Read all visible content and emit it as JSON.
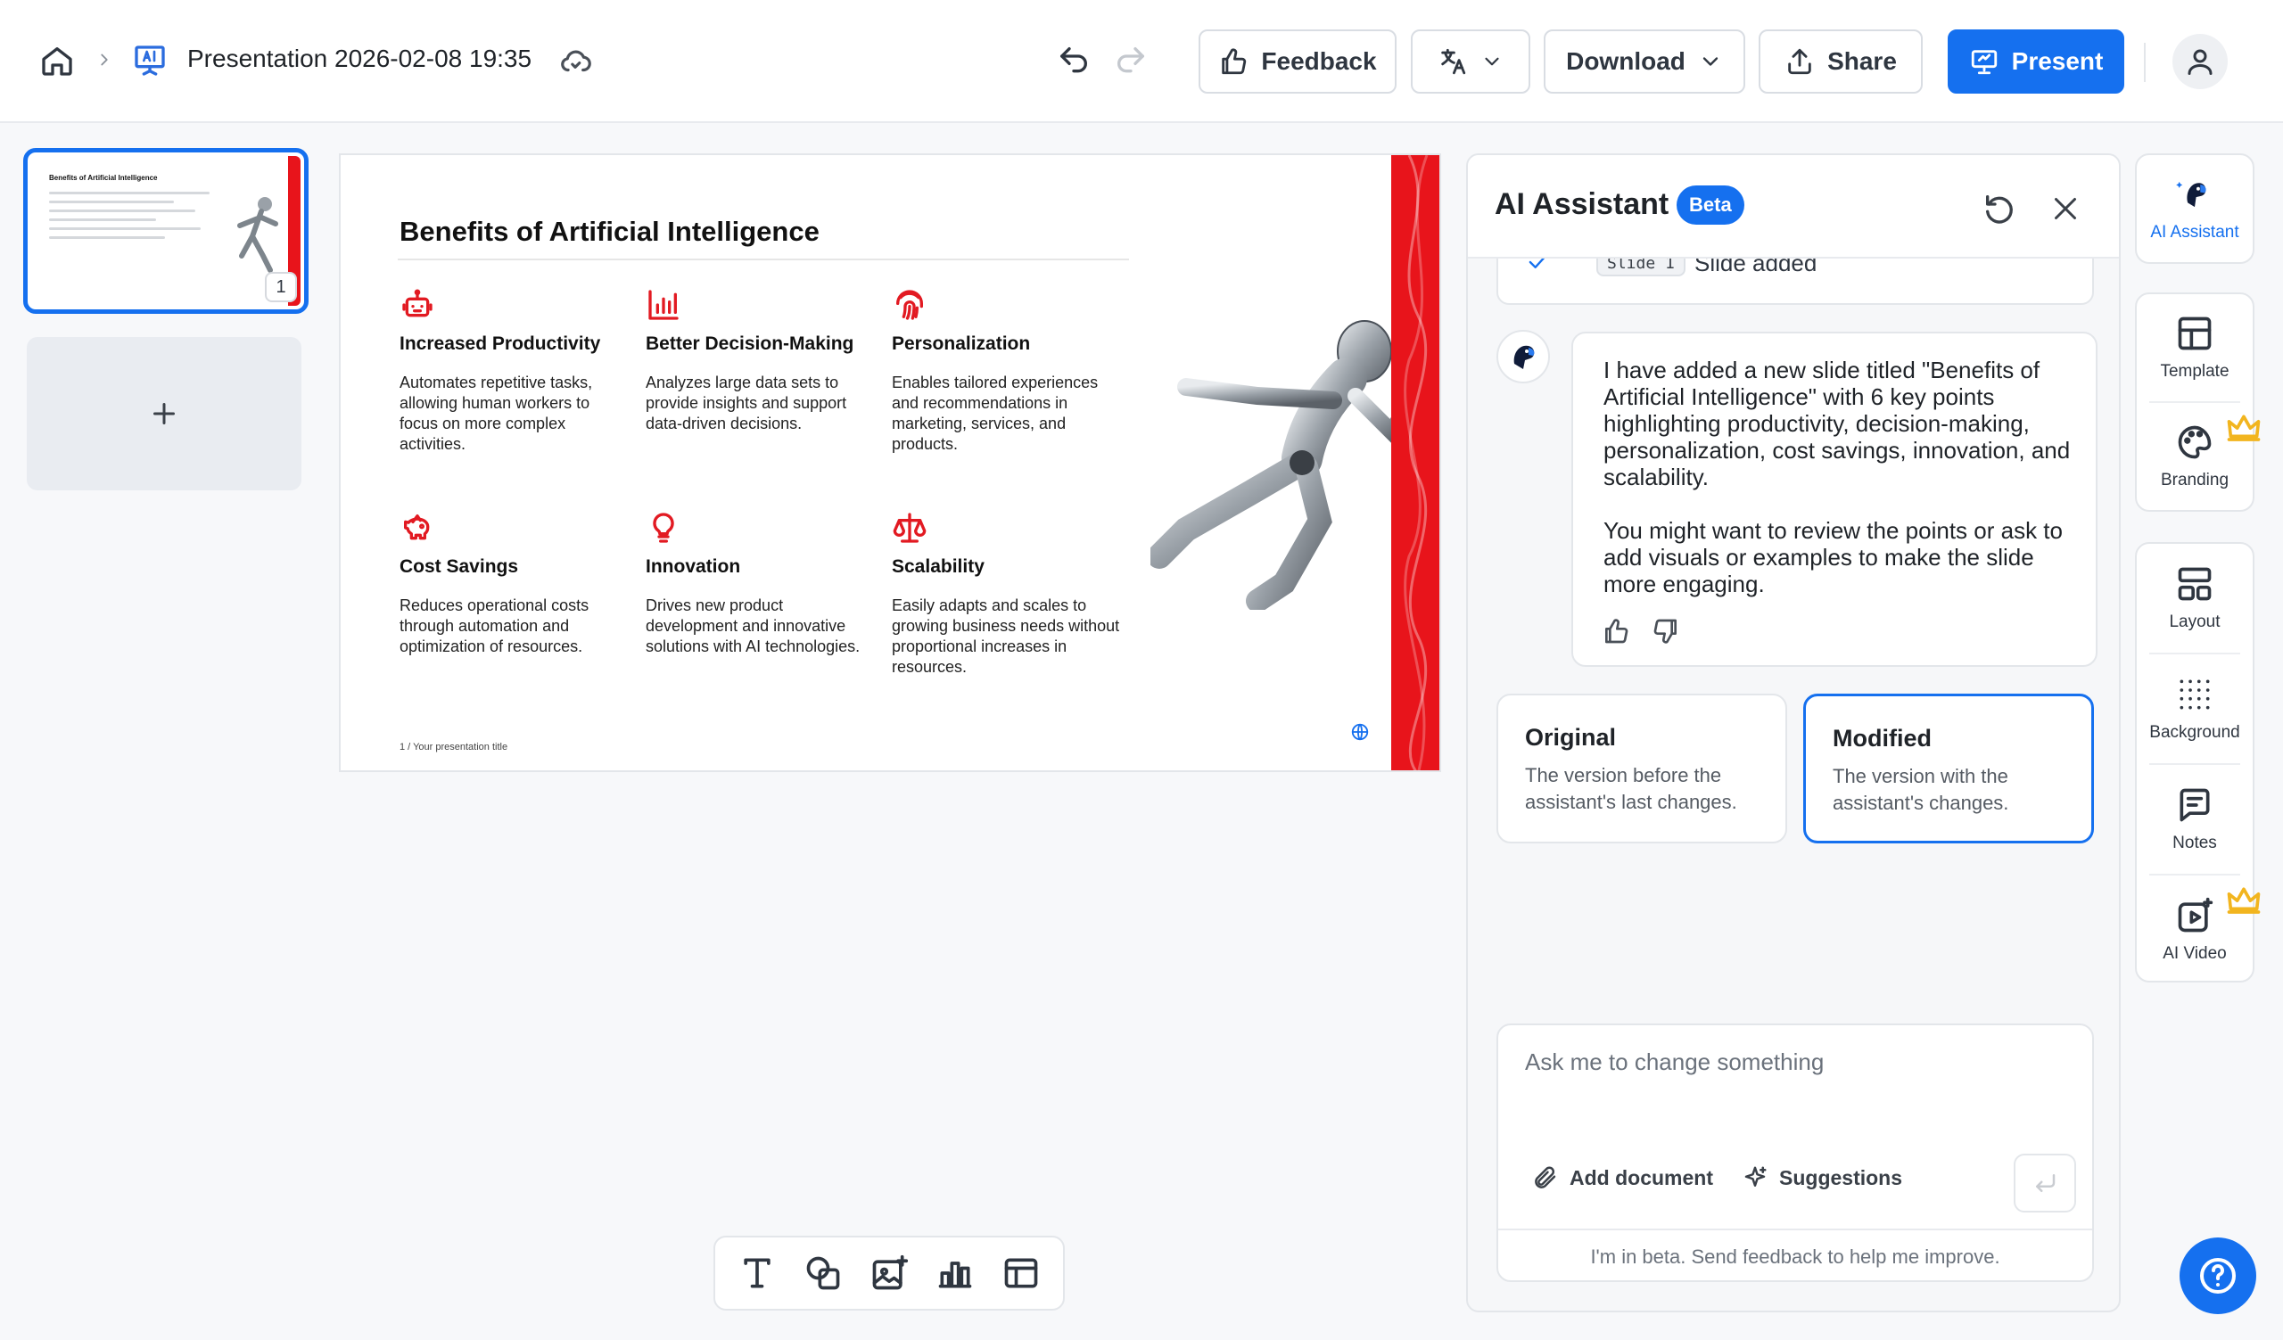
{
  "topbar": {
    "title": "Presentation 2026-02-08 19:35",
    "feedback_label": "Feedback",
    "download_label": "Download",
    "share_label": "Share",
    "present_label": "Present"
  },
  "thumbnails": {
    "slide_number": "1",
    "thumb_title": "Benefits of Artificial Intelligence"
  },
  "slide": {
    "title": "Benefits of Artificial Intelligence",
    "cards": [
      {
        "icon": "robot-icon",
        "title": "Increased Productivity",
        "desc": "Automates repetitive tasks, allowing human workers to focus on more complex activities."
      },
      {
        "icon": "bar-chart-icon",
        "title": "Better Decision-Making",
        "desc": "Analyzes large data sets to provide insights and support data-driven decisions."
      },
      {
        "icon": "fingerprint-icon",
        "title": "Personalization",
        "desc": "Enables tailored experiences and recommendations in marketing, services, and products."
      },
      {
        "icon": "piggy-bank-icon",
        "title": "Cost Savings",
        "desc": "Reduces operational costs through automation and optimization of resources."
      },
      {
        "icon": "lightbulb-icon",
        "title": "Innovation",
        "desc": "Drives new product development and innovative solutions with AI technologies."
      },
      {
        "icon": "scale-icon",
        "title": "Scalability",
        "desc": "Easily adapts and scales to growing business needs without proportional increases in resources."
      }
    ],
    "footer": "1  /  Your presentation title",
    "accent_color": "#e8141b"
  },
  "ai_panel": {
    "title": "AI Assistant",
    "badge": "Beta",
    "status_chip": "Slide 1",
    "status_text": "Slide added",
    "message_p1": "I have added a new slide titled \"Benefits of Artificial Intelligence\" with 6 key points highlighting productivity, decision-making, personalization, cost savings, innovation, and scalability.",
    "message_p2": "You might want to review the points or ask to add visuals or examples to make the slide more engaging.",
    "versions": [
      {
        "title": "Original",
        "desc": "The version before the assistant's last changes."
      },
      {
        "title": "Modified",
        "desc": "The version with the assistant's changes."
      }
    ],
    "input_placeholder": "Ask me to change something",
    "add_document_label": "Add document",
    "suggestions_label": "Suggestions",
    "footnote": "I'm in beta. Send feedback to help me improve."
  },
  "rail": {
    "ai_assistant": "AI Assistant",
    "template": "Template",
    "branding": "Branding",
    "layout": "Layout",
    "background": "Background",
    "notes": "Notes",
    "ai_video": "AI Video"
  },
  "colors": {
    "primary": "#1570ef",
    "slide_accent": "#e8141b"
  }
}
